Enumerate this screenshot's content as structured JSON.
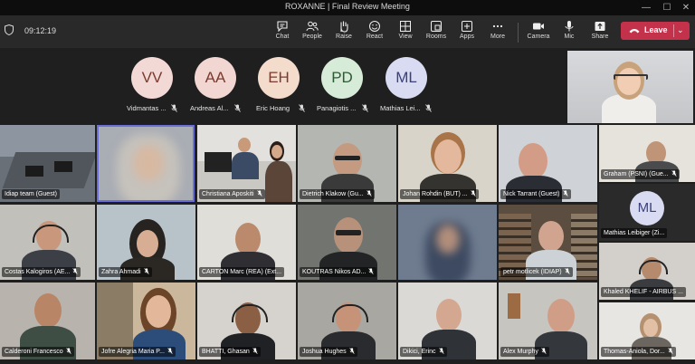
{
  "window": {
    "title": "ROXANNE | Final Review Meeting"
  },
  "toolbar": {
    "timer": "09:12:19",
    "buttons": [
      {
        "label": "Chat",
        "icon": "chat-icon"
      },
      {
        "label": "People",
        "icon": "people-icon"
      },
      {
        "label": "Raise",
        "icon": "raise-hand-icon"
      },
      {
        "label": "React",
        "icon": "react-icon"
      },
      {
        "label": "View",
        "icon": "view-icon"
      },
      {
        "label": "Rooms",
        "icon": "rooms-icon"
      },
      {
        "label": "Apps",
        "icon": "apps-icon"
      },
      {
        "label": "More",
        "icon": "more-icon"
      },
      {
        "label": "Camera",
        "icon": "camera-icon"
      },
      {
        "label": "Mic",
        "icon": "mic-icon"
      },
      {
        "label": "Share",
        "icon": "share-icon"
      }
    ],
    "leave_label": "Leave",
    "leave_color": "#c4314b"
  },
  "avatars": [
    {
      "initials": "VV",
      "name": "Vidmantas ...",
      "color": "#f3d9d5"
    },
    {
      "initials": "AA",
      "name": "Andreas Al...",
      "color": "#f2d6d2"
    },
    {
      "initials": "EH",
      "name": "Eric Hoang",
      "color": "#f4dccd"
    },
    {
      "initials": "PD",
      "name": "Panagiotis ...",
      "color": "#d7ecd8"
    },
    {
      "initials": "ML",
      "name": "Mathias Lei...",
      "color": "#d9dbf2"
    }
  ],
  "tiles": [
    {
      "name": "Idiap team (Guest)"
    },
    {
      "name": ""
    },
    {
      "name": "Christiana Aposkiti"
    },
    {
      "name": "Dietrich Klakow (Gu..."
    },
    {
      "name": "Johan Rohdin (BUT) ..."
    },
    {
      "name": "Nick Tarrant (Guest)"
    },
    {
      "name": "Graham (PSNI) (Gue..."
    },
    {
      "name": "Costas Kalogiros (AE..."
    },
    {
      "name": "Zahra Ahmadi"
    },
    {
      "name": "CARTON Marc (REA) (Ext..."
    },
    {
      "name": "KOUTRAS Nikos AD..."
    },
    {
      "name": ""
    },
    {
      "name": "petr motlicek (IDIAP)"
    },
    {
      "name": "Mathias Leibiger (Zi..."
    },
    {
      "name": "Khaled KHELIF - AIRBUS ..."
    },
    {
      "name": "Calderoni Francesco"
    },
    {
      "name": "Jofre Alegria Maria P..."
    },
    {
      "name": "BHATTI, Ghasan"
    },
    {
      "name": "Joshua Hughes"
    },
    {
      "name": "Dikici, Erinc"
    },
    {
      "name": "Alex Murphy"
    },
    {
      "name": "Thomas-Aniola, Dor..."
    }
  ],
  "ml_tile_initials": "ML",
  "ml_tile_color": "#d9dbf2"
}
